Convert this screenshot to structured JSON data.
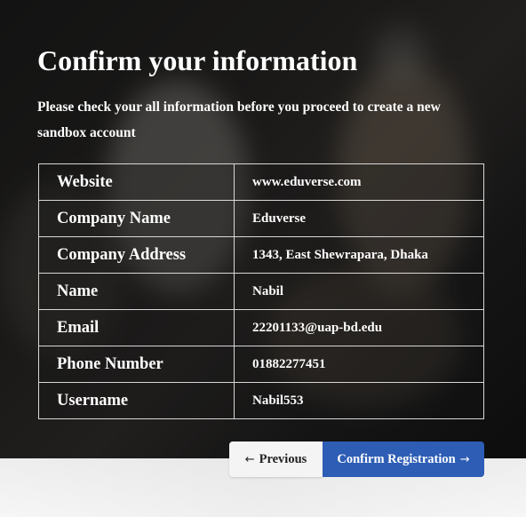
{
  "header": {
    "title": "Confirm your information",
    "subtitle": "Please check your all information before you proceed to create a new sandbox account"
  },
  "details": [
    {
      "label": "Website",
      "value": "www.eduverse.com"
    },
    {
      "label": "Company Name",
      "value": "Eduverse"
    },
    {
      "label": "Company Address",
      "value": "1343, East Shewrapara, Dhaka"
    },
    {
      "label": "Name",
      "value": "Nabil"
    },
    {
      "label": "Email",
      "value": "22201133@uap-bd.edu"
    },
    {
      "label": "Phone Number",
      "value": "01882277451"
    },
    {
      "label": "Username",
      "value": "Nabil553"
    }
  ],
  "buttons": {
    "previous_label": "Previous",
    "previous_icon": "arrow-left-icon",
    "confirm_label": "Confirm Registration",
    "confirm_icon": "arrow-right-icon"
  },
  "colors": {
    "confirm_button": "#2d5db5",
    "previous_button": "#f4f4f4",
    "text": "#ffffff"
  }
}
